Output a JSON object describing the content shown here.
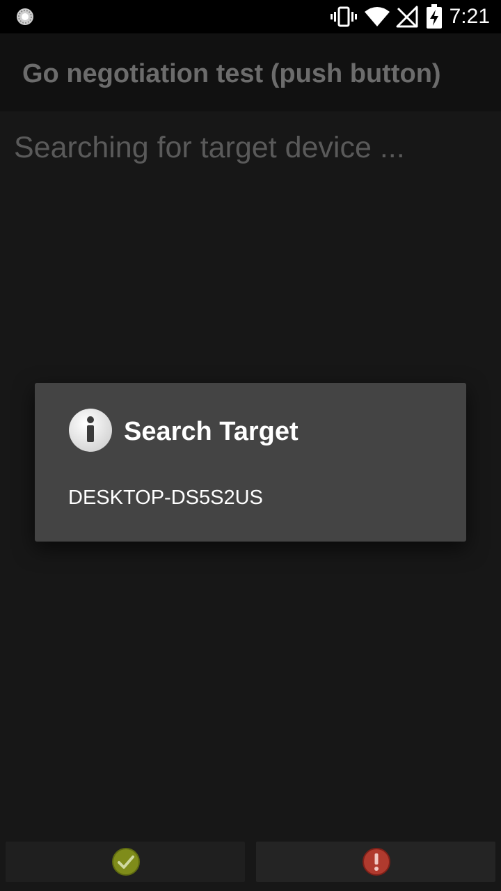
{
  "status_bar": {
    "time": "7:21",
    "icons": [
      "sync-icon",
      "vibrate-icon",
      "wifi-icon",
      "no-signal-icon",
      "battery-charging-icon"
    ]
  },
  "action_bar": {
    "title": "Go negotiation test (push button)"
  },
  "main": {
    "status_text": "Searching for target device ..."
  },
  "dialog": {
    "icon": "info-icon",
    "title": "Search Target",
    "items": [
      {
        "label": "DESKTOP-DS5S2US"
      }
    ]
  },
  "bottom_buttons": {
    "pass": {
      "icon": "check-icon",
      "color": "#8a9a1f"
    },
    "fail": {
      "icon": "error-icon",
      "color": "#c0392b"
    }
  },
  "colors": {
    "background": "#171717",
    "status_bar": "#000000",
    "action_bar": "#111111",
    "dialog": "#444444",
    "title_text": "#6c6c6c"
  }
}
